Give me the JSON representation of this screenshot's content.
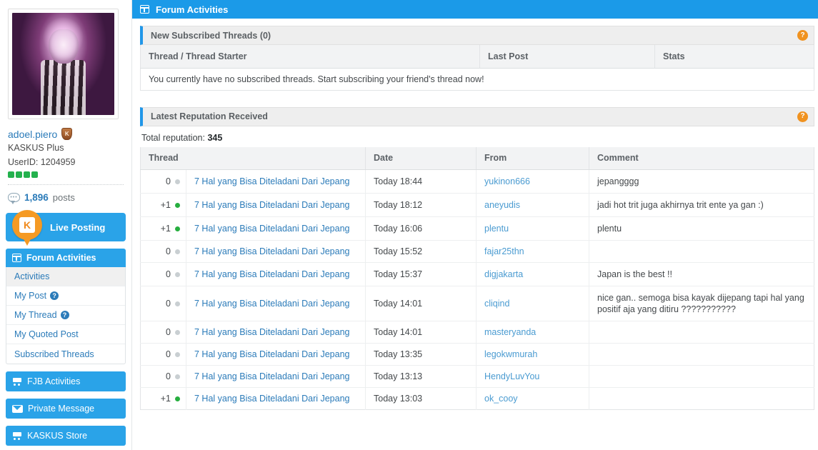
{
  "sidebar": {
    "avatar": {
      "name": "user-avatar",
      "alt": "adoel.piero avatar"
    },
    "user": {
      "username": "adoel.piero",
      "badge_icon": "shield-badge-icon",
      "badge_letter": "K",
      "membership": "KASKUS Plus",
      "userid_label": "UserID: 1204959",
      "rep_dots": 4
    },
    "posts": {
      "count": "1,896",
      "label": "posts",
      "icon": "comment-bubble-icon"
    },
    "live_posting": {
      "label": "Live Posting",
      "logo_letter": "K"
    },
    "forum_activities": {
      "label": "Forum Activities",
      "icon": "window-panel-icon",
      "items": [
        {
          "label": "Activities",
          "active": true,
          "help": false
        },
        {
          "label": "My Post",
          "active": false,
          "help": true
        },
        {
          "label": "My Thread",
          "active": false,
          "help": true
        },
        {
          "label": "My Quoted Post",
          "active": false,
          "help": false
        },
        {
          "label": "Subscribed Threads",
          "active": false,
          "help": false
        }
      ]
    },
    "sections": [
      {
        "label": "FJB Activities",
        "icon": "cart-icon"
      },
      {
        "label": "Private Message",
        "icon": "mail-icon"
      },
      {
        "label": "KASKUS Store",
        "icon": "cart-icon"
      }
    ]
  },
  "main": {
    "header": {
      "title": "Forum Activities",
      "icon": "window-panel-icon"
    },
    "subscribed": {
      "panel_title": "New Subscribed Threads (0)",
      "help_icon": "help-circle-icon",
      "columns": [
        "Thread / Thread Starter",
        "Last Post",
        "Stats"
      ],
      "empty_message": "You currently have no subscribed threads. Start subscribing your friend's thread now!"
    },
    "reputation": {
      "panel_title": "Latest Reputation Received",
      "help_icon": "help-circle-icon",
      "total_label": "Total reputation:",
      "total_value": "345",
      "columns": [
        "Thread",
        "Date",
        "From",
        "Comment"
      ],
      "rows": [
        {
          "score": "0",
          "polarity": "neutral",
          "thread": "7 Hal yang Bisa Diteladani Dari Jepang",
          "date": "Today 18:44",
          "from": "yukinon666",
          "comment": "jepangggg"
        },
        {
          "score": "+1",
          "polarity": "positive",
          "thread": "7 Hal yang Bisa Diteladani Dari Jepang",
          "date": "Today 18:12",
          "from": "aneyudis",
          "comment": "jadi hot trit juga akhirnya trit ente ya gan :)"
        },
        {
          "score": "+1",
          "polarity": "positive",
          "thread": "7 Hal yang Bisa Diteladani Dari Jepang",
          "date": "Today 16:06",
          "from": "plentu",
          "comment": "plentu"
        },
        {
          "score": "0",
          "polarity": "neutral",
          "thread": "7 Hal yang Bisa Diteladani Dari Jepang",
          "date": "Today 15:52",
          "from": "fajar25thn",
          "comment": ""
        },
        {
          "score": "0",
          "polarity": "neutral",
          "thread": "7 Hal yang Bisa Diteladani Dari Jepang",
          "date": "Today 15:37",
          "from": "digjakarta",
          "comment": "Japan is the best !!"
        },
        {
          "score": "0",
          "polarity": "neutral",
          "thread": "7 Hal yang Bisa Diteladani Dari Jepang",
          "date": "Today 14:01",
          "from": "cliqind",
          "comment": "nice gan.. semoga bisa kayak dijepang tapi hal yang positif aja yang ditiru ???????????"
        },
        {
          "score": "0",
          "polarity": "neutral",
          "thread": "7 Hal yang Bisa Diteladani Dari Jepang",
          "date": "Today 14:01",
          "from": "masteryanda",
          "comment": ""
        },
        {
          "score": "0",
          "polarity": "neutral",
          "thread": "7 Hal yang Bisa Diteladani Dari Jepang",
          "date": "Today 13:35",
          "from": "legokwmurah",
          "comment": ""
        },
        {
          "score": "0",
          "polarity": "neutral",
          "thread": "7 Hal yang Bisa Diteladani Dari Jepang",
          "date": "Today 13:13",
          "from": "HendyLuvYou",
          "comment": ""
        },
        {
          "score": "+1",
          "polarity": "positive",
          "thread": "7 Hal yang Bisa Diteladani Dari Jepang",
          "date": "Today 13:03",
          "from": "ok_cooy",
          "comment": ""
        }
      ]
    }
  },
  "colors": {
    "brand_blue": "#1b9ae8",
    "nav_blue": "#2aa3e8",
    "link_blue": "#2b7bb9",
    "accent_orange": "#f0921f",
    "positive_green": "#27ae3f",
    "neutral_gray": "#c9cfd2"
  }
}
